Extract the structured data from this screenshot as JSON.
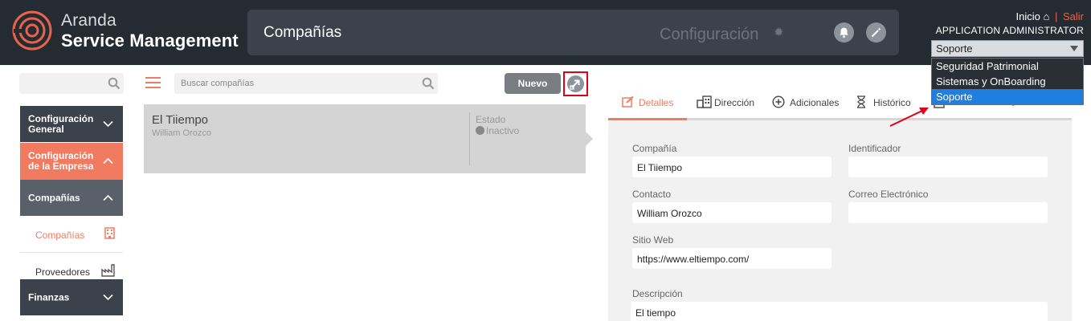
{
  "header": {
    "brand_line1": "Aranda",
    "brand_line2": "Service Management",
    "title": "Compañías",
    "config_label": "Configuración",
    "home_link": "Inicio",
    "separator": "|",
    "logout_link": "Salir",
    "user": "APPLICATION ADMINISTRATOR",
    "project_selected": "Soporte",
    "project_options": [
      "Seguridad Patrimonial",
      "Sistemas y OnBoarding",
      "Soporte"
    ]
  },
  "sidebar": {
    "items": [
      {
        "label": "Configuración General"
      },
      {
        "label": "Configuración de la Empresa"
      },
      {
        "label": "Compañías"
      }
    ],
    "sub_items": [
      {
        "label": "Compañías"
      },
      {
        "label": "Proveedores"
      }
    ],
    "bottom_item": {
      "label": "Finanzas"
    }
  },
  "list": {
    "search_placeholder": "Buscar compañías",
    "new_button": "Nuevo",
    "card": {
      "name": "El Tiiempo",
      "contact": "William Orozco",
      "state_label": "Estado",
      "state": "Inactivo"
    }
  },
  "detail": {
    "tabs": [
      {
        "label": "Detalles",
        "icon": "edit-icon"
      },
      {
        "label": "Dirección",
        "icon": "buildings-icon"
      },
      {
        "label": "Adicionales",
        "icon": "plus-circle-icon"
      },
      {
        "label": "Histórico",
        "icon": "hourglass-icon"
      }
    ],
    "fields": {
      "company_label": "Compañía",
      "company_value": "El Tiiempo",
      "identifier_label": "Identificador",
      "identifier_value": "",
      "contact_label": "Contacto",
      "contact_value": "William Orozco",
      "email_label": "Correo Electrónico",
      "email_value": "",
      "website_label": "Sitio Web",
      "website_value": "https://www.eltiempo.com/",
      "description_label": "Descripción",
      "description_value": "El tiempo"
    }
  },
  "colors": {
    "accent": "#f07b61",
    "header_bg": "#252b33",
    "highlight_red": "#e0001a",
    "dropdown_selected": "#1e7fe0"
  }
}
